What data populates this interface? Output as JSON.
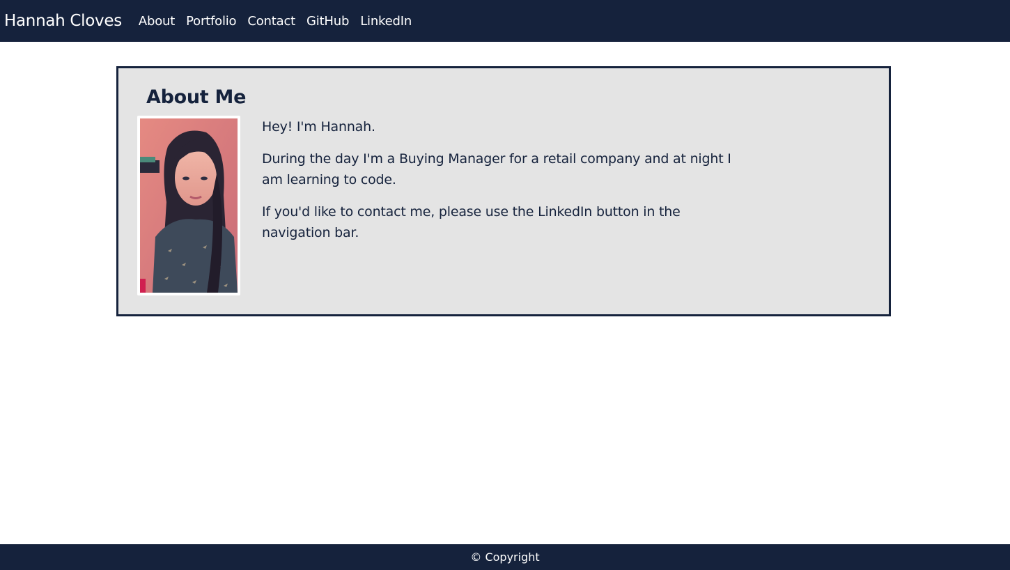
{
  "nav": {
    "brand": "Hannah Cloves",
    "links": [
      {
        "label": "About"
      },
      {
        "label": "Portfolio"
      },
      {
        "label": "Contact"
      },
      {
        "label": "GitHub"
      },
      {
        "label": "LinkedIn"
      }
    ]
  },
  "about": {
    "title": "About Me",
    "paragraphs": [
      "Hey! I'm Hannah.",
      "During the day I'm a Buying Manager for a retail company and at night I am learning to code.",
      "If you'd like to contact me, please use the LinkedIn button in the navigation bar."
    ]
  },
  "footer": {
    "text": "© Copyright"
  },
  "colors": {
    "navy": "#15223c",
    "card_bg": "#e4e4e4",
    "white": "#ffffff"
  }
}
